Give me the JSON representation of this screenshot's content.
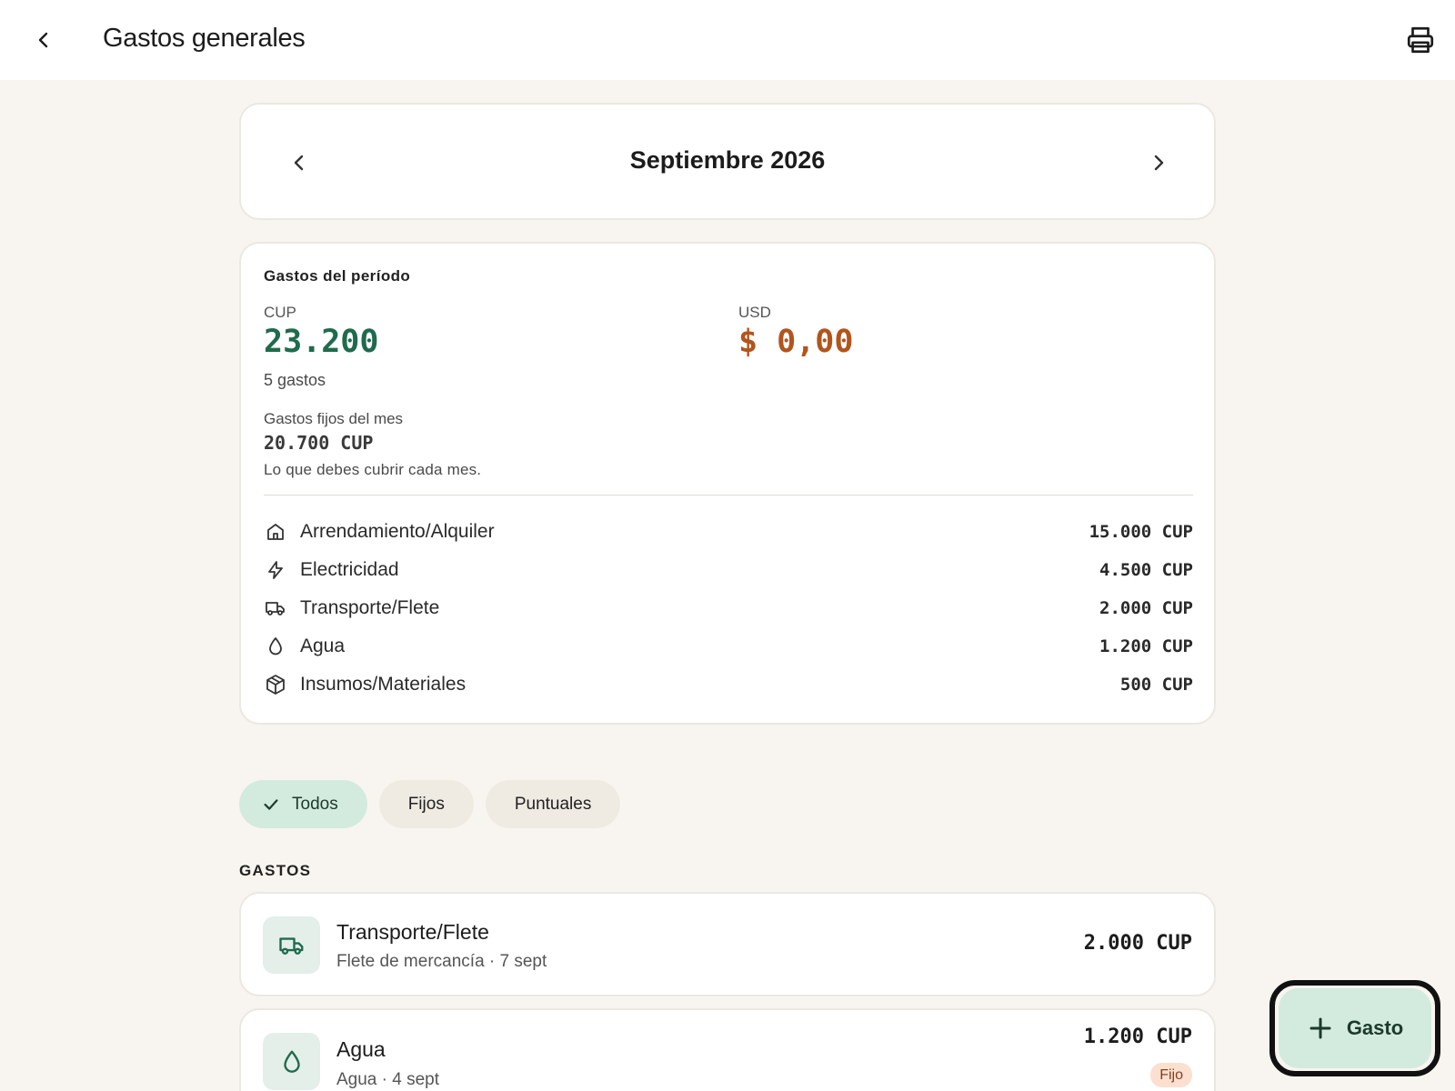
{
  "header": {
    "title": "Gastos generales",
    "back_icon": "arrow-back-icon",
    "print_icon": "printer-icon"
  },
  "period": {
    "label": "Septiembre 2026",
    "prev_icon": "chevron-left-icon",
    "next_icon": "chevron-right-icon"
  },
  "summary": {
    "heading": "Gastos del período",
    "cup": {
      "label": "CUP",
      "amount": "23.200"
    },
    "usd": {
      "label": "USD",
      "amount": "$ 0,00"
    },
    "count": "5 gastos",
    "fixed_label": "Gastos fijos del mes",
    "fixed_amount": "20.700 CUP",
    "fixed_note": "Lo que debes cubrir cada mes.",
    "categories": [
      {
        "icon": "home-icon",
        "name": "Arrendamiento/Alquiler",
        "amount": "15.000 CUP"
      },
      {
        "icon": "lightning-icon",
        "name": "Electricidad",
        "amount": "4.500 CUP"
      },
      {
        "icon": "truck-icon",
        "name": "Transporte/Flete",
        "amount": "2.000 CUP"
      },
      {
        "icon": "water-drop-icon",
        "name": "Agua",
        "amount": "1.200 CUP"
      },
      {
        "icon": "box-icon",
        "name": "Insumos/Materiales",
        "amount": "500 CUP"
      }
    ]
  },
  "filters": {
    "items": [
      {
        "label": "Todos",
        "active": true
      },
      {
        "label": "Fijos",
        "active": false
      },
      {
        "label": "Puntuales",
        "active": false
      }
    ]
  },
  "list": {
    "section_title": "GASTOS",
    "expenses": [
      {
        "icon": "truck-icon",
        "name": "Transporte/Flete",
        "desc": "Flete de mercancía · 7 sept",
        "amount": "2.000 CUP",
        "badge": ""
      },
      {
        "icon": "water-drop-icon",
        "name": "Agua",
        "desc": "Agua · 4 sept",
        "amount": "1.200 CUP",
        "badge": "Fijo"
      }
    ]
  },
  "fab": {
    "label": "Gasto",
    "icon": "plus-icon"
  },
  "colors": {
    "accent_green": "#1f6b4d",
    "usd_orange": "#b2551c",
    "chip_active": "#d3ebde",
    "background": "#f8f5f0"
  }
}
